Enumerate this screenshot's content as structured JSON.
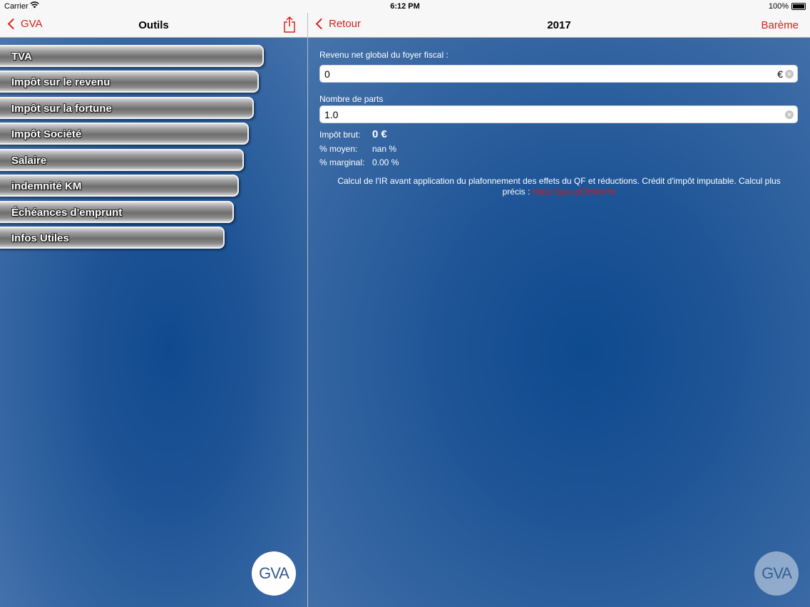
{
  "status_bar": {
    "carrier": "Carrier",
    "time": "6:12 PM",
    "battery": "100%"
  },
  "left_nav": {
    "back_label": "GVA",
    "title": "Outils"
  },
  "right_nav": {
    "back_label": "Retour",
    "title": "2017",
    "action_label": "Barème"
  },
  "menu": {
    "items": [
      {
        "label": "TVA"
      },
      {
        "label": "Impôt sur le revenu"
      },
      {
        "label": "Impôt sur la fortune"
      },
      {
        "label": "Impôt Société"
      },
      {
        "label": "Salaire"
      },
      {
        "label": "indemnité KM"
      },
      {
        "label": "Échéances d'emprunt"
      },
      {
        "label": "Infos Utiles"
      }
    ]
  },
  "form": {
    "revenu_label": "Revenu net global du foyer fiscal :",
    "revenu_value": "0",
    "revenu_unit": "€",
    "parts_label": "Nombre de parts",
    "parts_value": "1.0"
  },
  "results": {
    "impot_brut_label": "Impôt brut:",
    "impot_brut_value": "0 €",
    "moyen_label": "% moyen:",
    "moyen_value": "nan %",
    "marginal_label": "% marginal:",
    "marginal_value": "0.00 %"
  },
  "note": {
    "text": "Calcul de l'IR avant application du plafonnement des effets du QF et réductions. Crédit d'impôt imputable. Calcul plus précis : ",
    "link": "https://goo.gl/3bMsHb"
  },
  "logo": {
    "text": "GVA"
  },
  "colors": {
    "accent": "#d2231f",
    "background": "#2a5d9a"
  }
}
